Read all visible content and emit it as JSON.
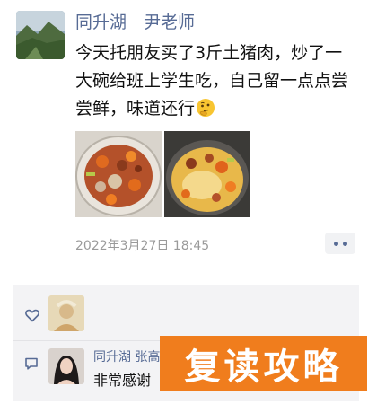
{
  "post": {
    "author": "同升湖　尹老师",
    "text": "今天托朋友买了3斤土猪肉，炒了一大碗给班上学生吃，自己留一点点尝尝鲜，味道还行",
    "emoji": "thinking-face-icon",
    "timestamp": "2022年3月27日 18:45",
    "images": [
      "stir-fried-pork-bowl-photo",
      "pork-in-wok-photo"
    ]
  },
  "interactions": {
    "like_icon": "heart-outline-icon",
    "comment_icon": "comment-bubble-icon",
    "comment": {
      "author": "同升湖 张高",
      "text": "非常感谢"
    }
  },
  "watermark": {
    "text": "复读攻略"
  },
  "colors": {
    "link_blue": "#576b95",
    "panel_bg": "#f3f3f5",
    "watermark_orange": "#f07d1d",
    "timestamp_gray": "#9a9a9a"
  }
}
